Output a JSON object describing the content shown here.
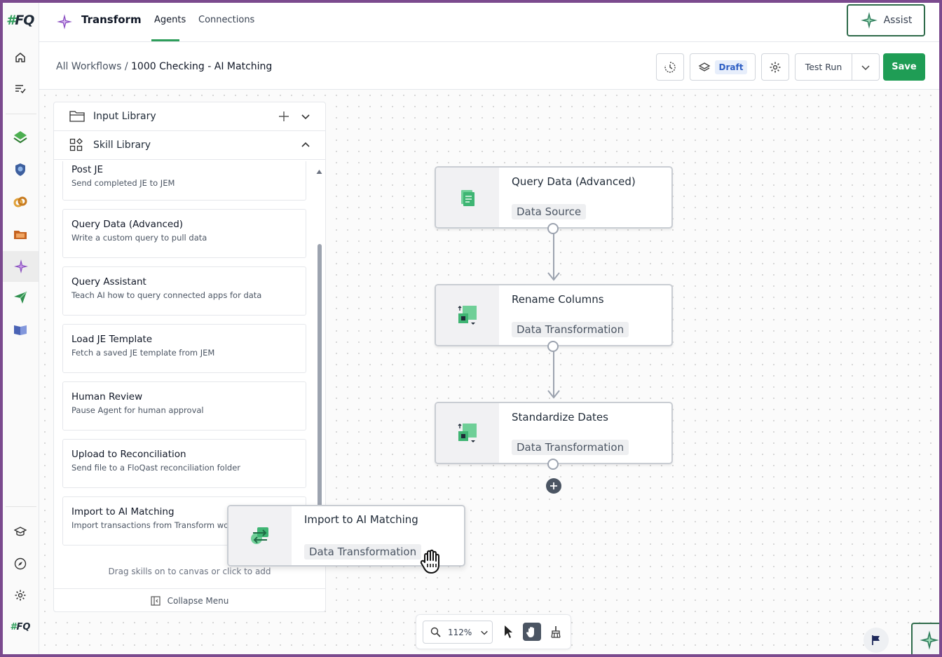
{
  "header": {
    "app_title": "Transform",
    "tabs": [
      {
        "label": "Agents",
        "active": true
      },
      {
        "label": "Connections",
        "active": false
      }
    ],
    "assist_label": "Assist"
  },
  "rail": {
    "logo": "FQ",
    "top_items": [
      "home-icon",
      "tasks-icon"
    ],
    "app_items": [
      "checklist-app-icon",
      "shield-app-icon",
      "link-app-icon",
      "folder-app-icon",
      "transform-app-icon",
      "send-app-icon",
      "book-app-icon"
    ],
    "bottom_items": [
      "learn-icon",
      "compass-icon",
      "settings-icon",
      "floqast-icon"
    ]
  },
  "subheader": {
    "breadcrumb_root": "All Workflows",
    "breadcrumb_sep": "/",
    "breadcrumb_current": "1000 Checking - AI Matching",
    "status": "Draft",
    "test_run_label": "Test Run",
    "save_label": "Save"
  },
  "panel": {
    "input_library": "Input Library",
    "skill_library": "Skill Library",
    "skills": [
      {
        "title": "Post JE",
        "desc": "Send completed JE to JEM"
      },
      {
        "title": "Query Data (Advanced)",
        "desc": "Write a custom query to pull data"
      },
      {
        "title": "Query Assistant",
        "desc": "Teach AI how to query connected apps for data"
      },
      {
        "title": "Load JE Template",
        "desc": "Fetch a saved JE template from JEM"
      },
      {
        "title": "Human Review",
        "desc": "Pause Agent for human approval"
      },
      {
        "title": "Upload to Reconciliation",
        "desc": "Send file to a FloQast reconciliation folder"
      },
      {
        "title": "Import to AI Matching",
        "desc": "Import transactions from Transform workflow"
      }
    ],
    "hint": "Drag skills on to canvas or click to add",
    "collapse_label": "Collapse Menu"
  },
  "canvas": {
    "nodes": [
      {
        "title": "Query Data (Advanced)",
        "tag": "Data Source",
        "icon": "query-data-icon"
      },
      {
        "title": "Rename Columns",
        "tag": "Data Transformation",
        "icon": "transform-icon"
      },
      {
        "title": "Standardize Dates",
        "tag": "Data Transformation",
        "icon": "transform-icon"
      }
    ],
    "dragging": {
      "title": "Import to AI Matching",
      "tag": "Data Transformation",
      "icon": "swap-icon"
    }
  },
  "zoom": {
    "level": "112%"
  },
  "colors": {
    "accent": "#1f9d55",
    "frame": "#7b4a8e",
    "draft_text": "#2f5fc4"
  }
}
